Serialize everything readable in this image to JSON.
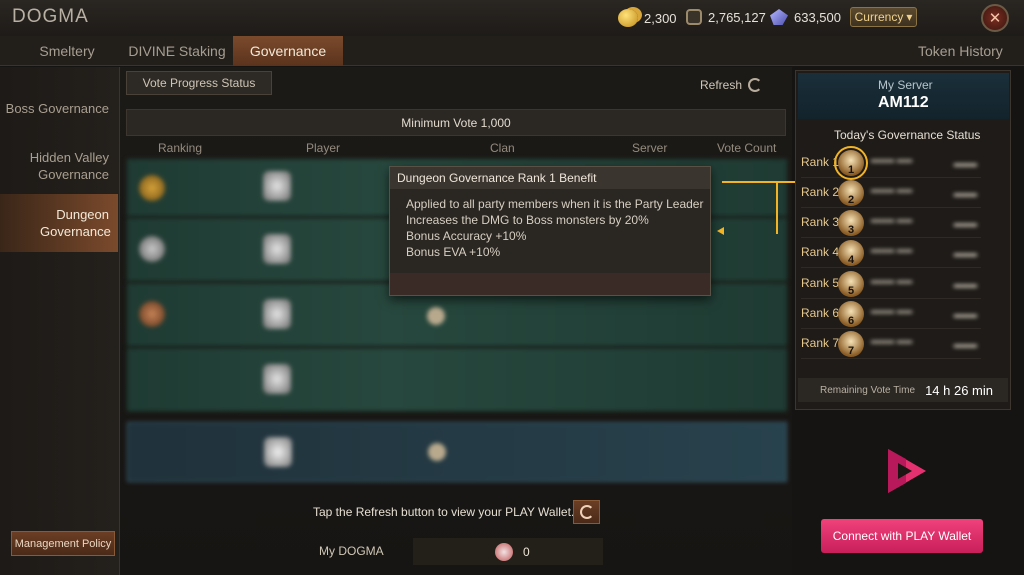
{
  "app": {
    "title": "DOGMA"
  },
  "currencies": [
    {
      "icon": "gold-coins-icon",
      "value": "2,300"
    },
    {
      "icon": "ring-token-icon",
      "value": "2,765,127"
    },
    {
      "icon": "crystal-icon",
      "value": "633,500"
    }
  ],
  "currency_button": "Currency",
  "tabs": [
    {
      "label": "Smeltery",
      "active": false
    },
    {
      "label": "DIVINE Staking",
      "active": false
    },
    {
      "label": "Governance",
      "active": true
    }
  ],
  "token_history": "Token History",
  "sidebar": {
    "items": [
      {
        "label": "Boss Governance",
        "active": false
      },
      {
        "label": "Hidden Valley Governance",
        "active": false
      },
      {
        "label": "Dungeon Governance",
        "active": true
      }
    ],
    "policy_button": "Management Policy"
  },
  "main": {
    "subtab": "Vote Progress Status",
    "refresh": "Refresh",
    "min_vote": "Minimum Vote 1,000",
    "columns": [
      "Ranking",
      "Player",
      "Clan",
      "Server",
      "Vote Count"
    ]
  },
  "tooltip": {
    "title": "Dungeon Governance Rank 1 Benefit",
    "lines": [
      "Applied to all party members when it is the Party Leader",
      "Increases the DMG to Boss monsters by 20%",
      "Bonus Accuracy +10%",
      "Bonus EVA +10%"
    ]
  },
  "wallet": {
    "prompt": "Tap the Refresh button to view your PLAY Wallet.",
    "my_label": "My DOGMA",
    "my_value": "0",
    "connect_button": "Connect with PLAY Wallet"
  },
  "server_panel": {
    "label": "My Server",
    "name": "AM112",
    "status_title": "Today's Governance Status",
    "ranks": [
      {
        "label": "Rank 1",
        "badge": "1"
      },
      {
        "label": "Rank 2",
        "badge": "2"
      },
      {
        "label": "Rank 3",
        "badge": "3"
      },
      {
        "label": "Rank 4",
        "badge": "4"
      },
      {
        "label": "Rank 5",
        "badge": "5"
      },
      {
        "label": "Rank 6",
        "badge": "6"
      },
      {
        "label": "Rank 7",
        "badge": "7"
      }
    ],
    "remaining_label": "Remaining Vote Time",
    "remaining_value": "14 h 26 min"
  },
  "colors": {
    "accent_orange": "#7b4a2c",
    "highlight_yellow": "#f2b324",
    "play_pink": "#e63170"
  }
}
